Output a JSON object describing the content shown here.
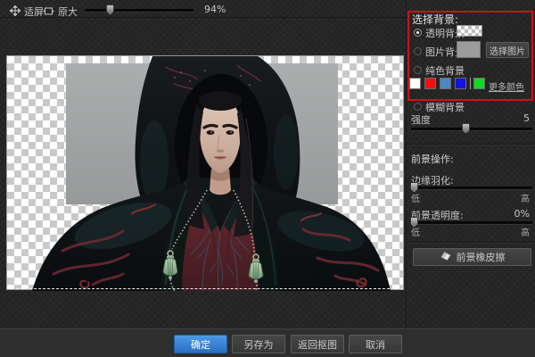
{
  "window": {
    "accent_blue": "#3b84d6",
    "annotation_red": "#d01111"
  },
  "toolbar": {
    "fit_screen_label": "适屏",
    "original_size_label": "原大",
    "zoom_value": "94%",
    "zoom_slider_percent": 22
  },
  "canvas": {
    "content_name": "hooded-man-portrait-cutout-on-transparency"
  },
  "icons": {
    "fit_screen": "move-crosshair",
    "original_size": "frame-arrows",
    "eraser": "eraser"
  },
  "background_panel": {
    "title": "选择背景:",
    "options": [
      {
        "label": "透明背景",
        "selected": true
      },
      {
        "label": "图片背景",
        "selected": false
      },
      {
        "label": "纯色背景",
        "selected": false
      },
      {
        "label": "模糊背景",
        "selected": false
      }
    ],
    "select_image_button": "选择图片",
    "swatches": [
      "#ffffff",
      "#ee1111",
      "#4d87c7",
      "#1414e0",
      "#0ddd22"
    ],
    "more_colors_label": "更多颜色",
    "strength_label": "强度",
    "strength_value": "5",
    "strength_slider_percent": 46
  },
  "foreground_panel": {
    "title": "前景操作:",
    "feather_label": "边缘羽化:",
    "feather_low": "低",
    "feather_high": "高",
    "feather_slider_percent": 0,
    "opacity_label": "前景透明度:",
    "opacity_value": "0%",
    "opacity_low": "低",
    "opacity_high": "高",
    "opacity_slider_percent": 0,
    "eraser_button": "前景橡皮擦"
  },
  "footer": {
    "confirm": "确定",
    "save_as": "另存为",
    "back_to_cutout": "返回抠图",
    "cancel": "取消"
  }
}
